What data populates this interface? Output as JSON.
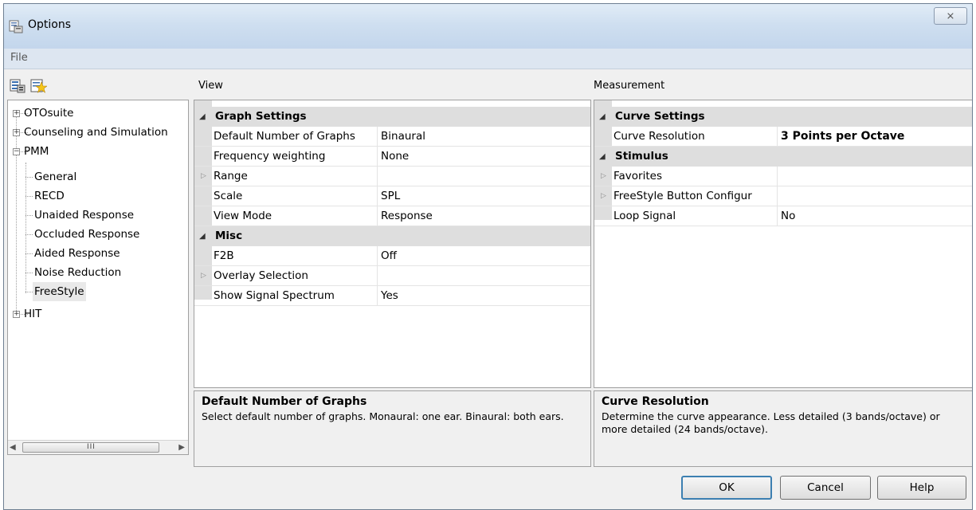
{
  "window": {
    "title": "Options",
    "close_glyph": "⨯"
  },
  "menu": {
    "file": "File"
  },
  "toolbar": {
    "buttons": [
      {
        "icon": "grid-sort-icon"
      },
      {
        "icon": "favorites-star-icon"
      }
    ]
  },
  "sections": {
    "view": "View",
    "measurement": "Measurement"
  },
  "tree": {
    "nodes": [
      {
        "label": "OTOsuite",
        "level": 0,
        "expander": "+"
      },
      {
        "label": "Counseling and Simulation",
        "level": 0,
        "expander": "+"
      },
      {
        "label": "PMM",
        "level": 0,
        "expander": "−"
      },
      {
        "label": "General",
        "level": 1
      },
      {
        "label": "RECD",
        "level": 1
      },
      {
        "label": "Unaided Response",
        "level": 1
      },
      {
        "label": "Occluded Response",
        "level": 1
      },
      {
        "label": "Aided Response",
        "level": 1
      },
      {
        "label": "Noise Reduction",
        "level": 1
      },
      {
        "label": "FreeStyle",
        "level": 1,
        "selected": true
      },
      {
        "label": "HIT",
        "level": 0,
        "expander": "+"
      }
    ],
    "scroll_grip": "III"
  },
  "view_grid": {
    "categories": [
      {
        "label": "Graph Settings",
        "rows": [
          {
            "name": "Default Number of Graphs",
            "value": "Binaural"
          },
          {
            "name": "Frequency weighting",
            "value": "None"
          },
          {
            "name": "Range",
            "value": "",
            "expandable": true
          },
          {
            "name": "Scale",
            "value": "SPL"
          },
          {
            "name": "View Mode",
            "value": "Response"
          }
        ]
      },
      {
        "label": "Misc",
        "rows": [
          {
            "name": "F2B",
            "value": "Off"
          },
          {
            "name": "Overlay Selection",
            "value": "",
            "expandable": true
          },
          {
            "name": "Show Signal Spectrum",
            "value": "Yes"
          }
        ]
      }
    ]
  },
  "measure_grid": {
    "categories": [
      {
        "label": "Curve Settings",
        "rows": [
          {
            "name": "Curve Resolution",
            "value": "3 Points per Octave",
            "bold": true
          }
        ]
      },
      {
        "label": "Stimulus",
        "rows": [
          {
            "name": "Favorites",
            "value": "",
            "expandable": true
          },
          {
            "name": "FreeStyle Button Configur",
            "value": "",
            "expandable": true
          },
          {
            "name": "Loop Signal",
            "value": "No"
          }
        ]
      }
    ]
  },
  "view_desc": {
    "title": "Default Number of Graphs",
    "text": "Select default number of graphs. Monaural: one ear. Binaural: both ears."
  },
  "measure_desc": {
    "title": "Curve Resolution",
    "text": "Determine the curve appearance. Less detailed (3 bands/octave) or more detailed (24 bands/octave)."
  },
  "buttons": {
    "ok": "OK",
    "cancel": "Cancel",
    "help": "Help"
  }
}
